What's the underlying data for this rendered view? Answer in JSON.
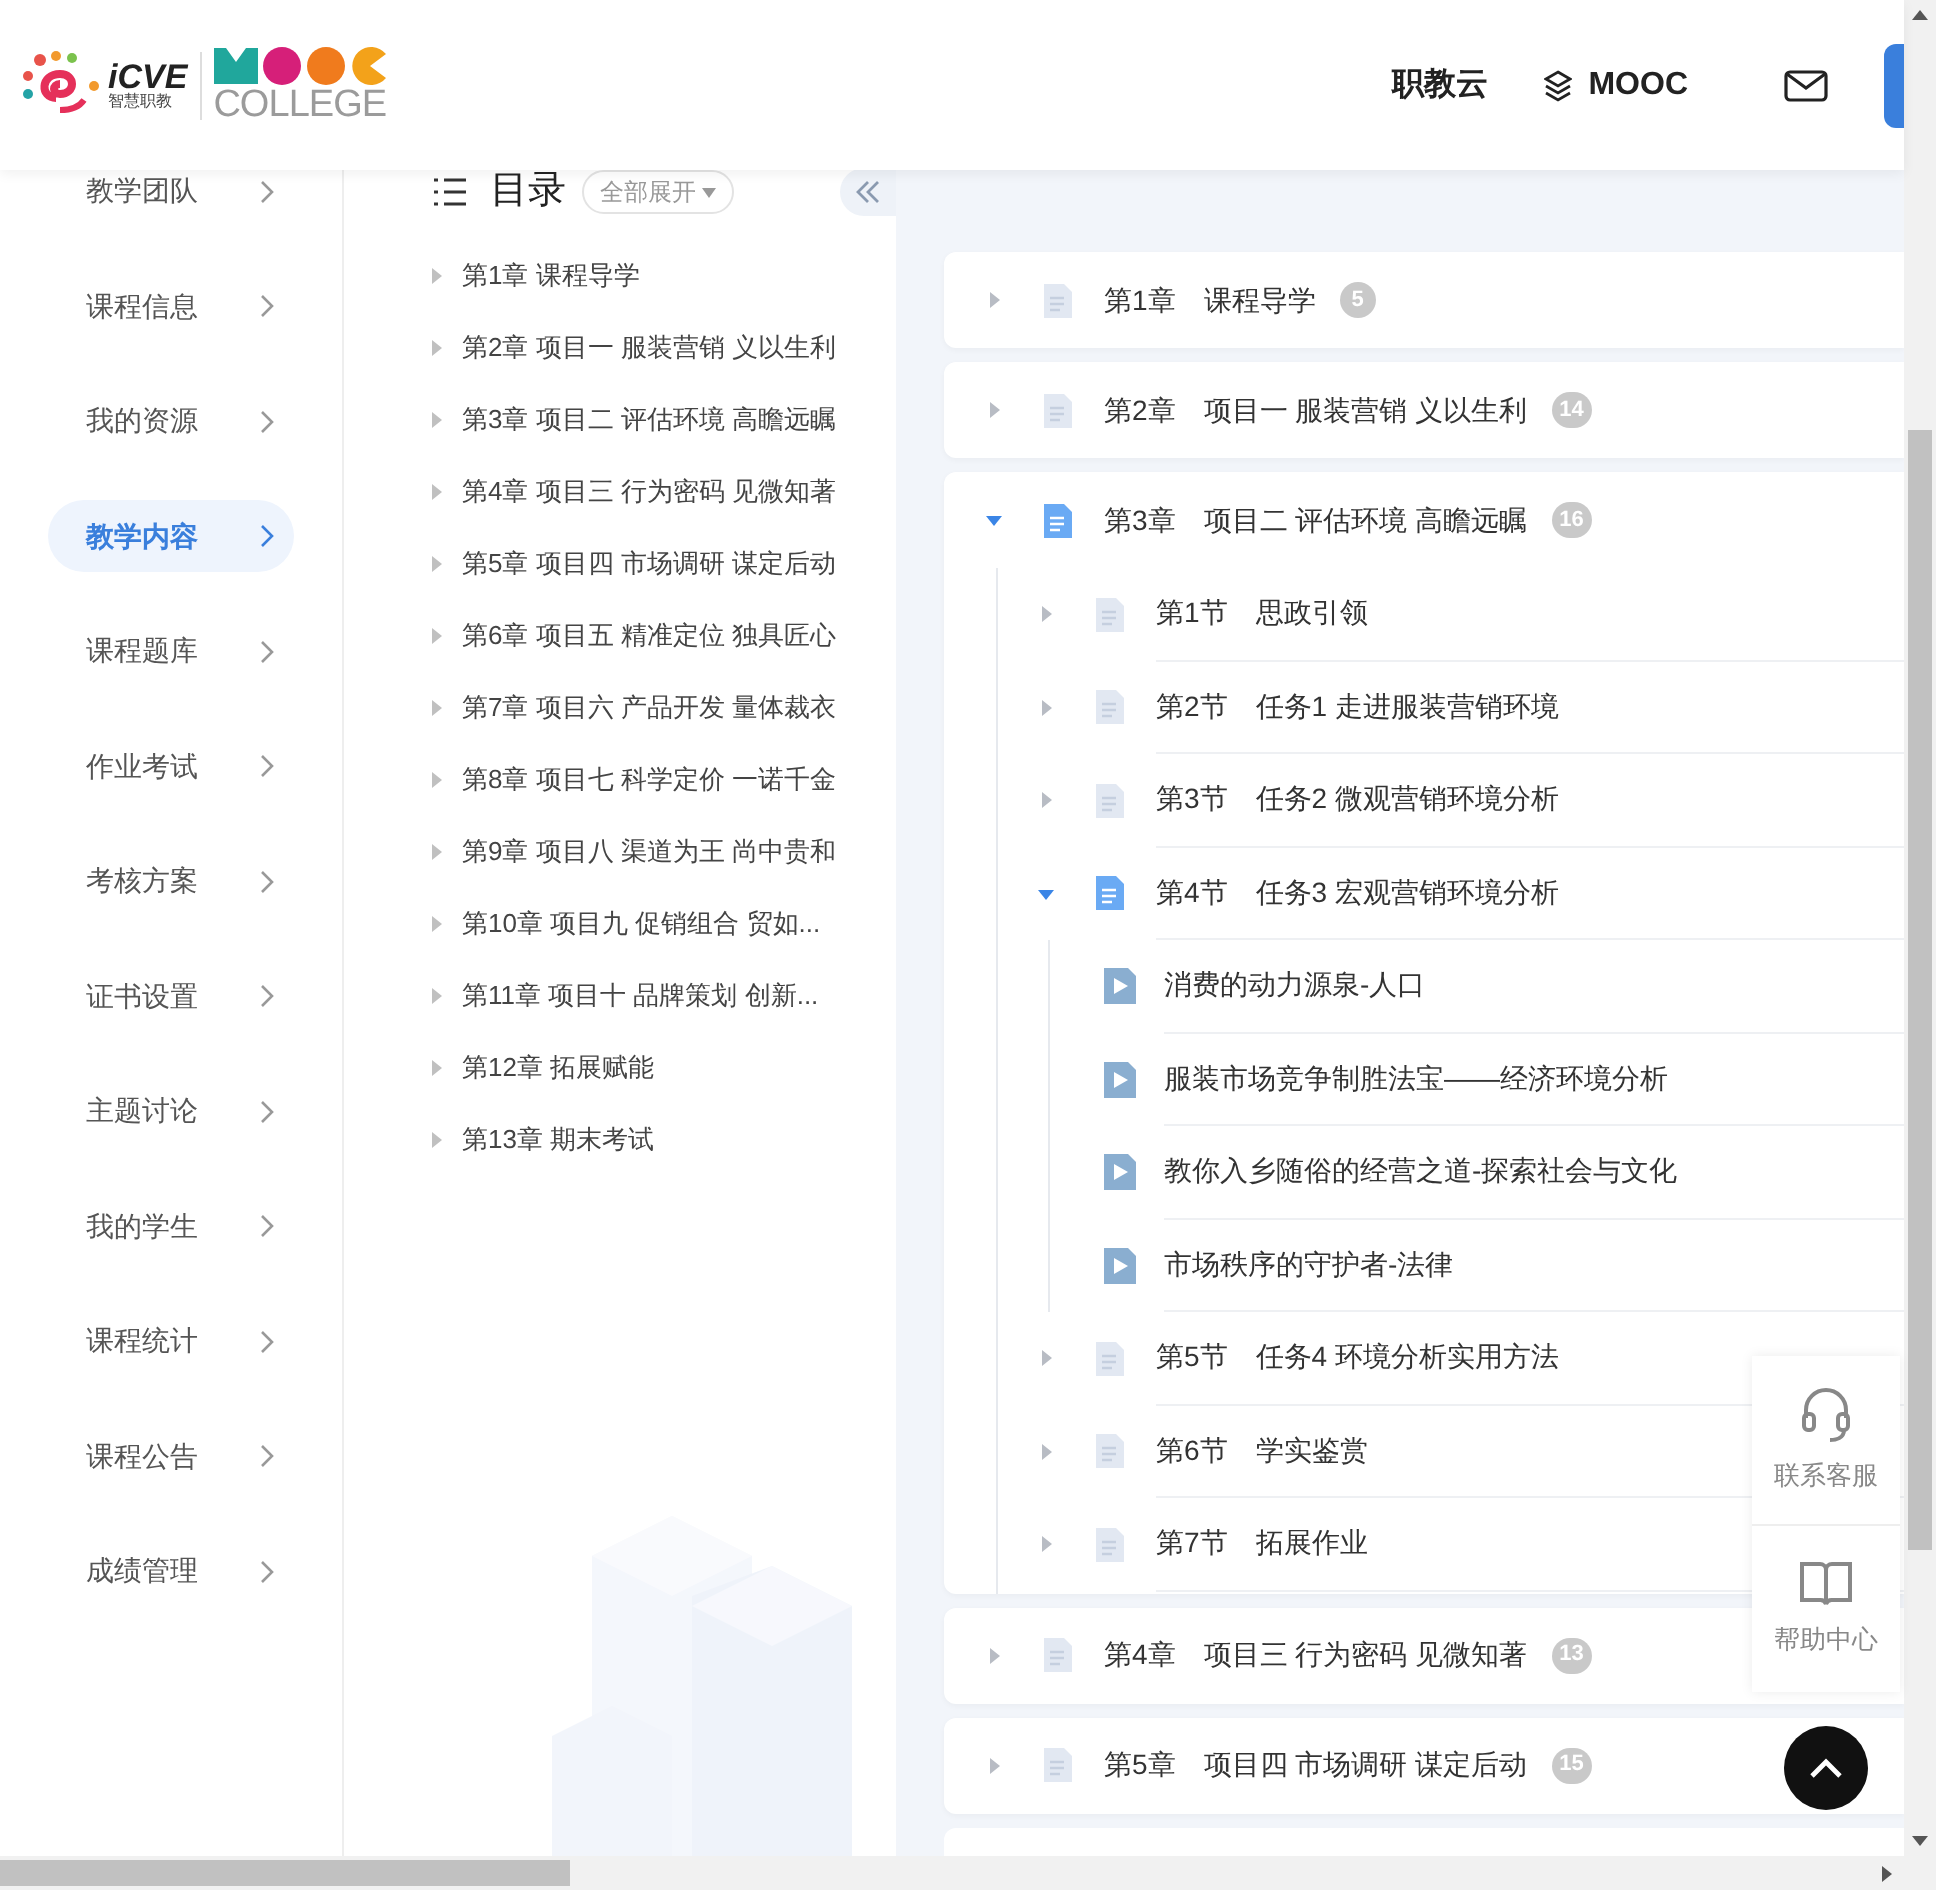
{
  "header": {
    "logo": {
      "brand": "iCVE",
      "brand_sub": "智慧职教",
      "college": "COLLEGE"
    },
    "nav": [
      {
        "label": "职教云",
        "kind": "text"
      },
      {
        "label": "MOOC",
        "kind": "layers"
      }
    ]
  },
  "sidebar": {
    "items": [
      {
        "label": "教学团队",
        "selected": false
      },
      {
        "label": "课程信息",
        "selected": false
      },
      {
        "label": "我的资源",
        "selected": false
      },
      {
        "label": "教学内容",
        "selected": true
      },
      {
        "label": "课程题库",
        "selected": false
      },
      {
        "label": "作业考试",
        "selected": false
      },
      {
        "label": "考核方案",
        "selected": false
      },
      {
        "label": "证书设置",
        "selected": false
      },
      {
        "label": "主题讨论",
        "selected": false
      },
      {
        "label": "我的学生",
        "selected": false
      },
      {
        "label": "课程统计",
        "selected": false
      },
      {
        "label": "课程公告",
        "selected": false
      },
      {
        "label": "成绩管理",
        "selected": false
      }
    ]
  },
  "catalog": {
    "title": "目录",
    "expand_all": "全部展开",
    "chapters": [
      {
        "label": "第1章 课程导学"
      },
      {
        "label": "第2章 项目一 服装营销 义以生利"
      },
      {
        "label": "第3章 项目二 评估环境 高瞻远瞩"
      },
      {
        "label": "第4章 项目三 行为密码 见微知著"
      },
      {
        "label": "第5章 项目四 市场调研 谋定后动"
      },
      {
        "label": "第6章 项目五 精准定位 独具匠心"
      },
      {
        "label": "第7章 项目六 产品开发 量体裁衣"
      },
      {
        "label": "第8章 项目七 科学定价 一诺千金"
      },
      {
        "label": "第9章 项目八 渠道为王 尚中贵和"
      },
      {
        "label": "第10章 项目九 促销组合 贸如..."
      },
      {
        "label": "第11章 项目十 品牌策划 创新..."
      },
      {
        "label": "第12章 拓展赋能"
      },
      {
        "label": "第13章 期末考试"
      }
    ]
  },
  "content": {
    "chapters": [
      {
        "number": "第1章",
        "title": "课程导学",
        "count": "5",
        "expanded": false
      },
      {
        "number": "第2章",
        "title": "项目一 服装营销 义以生利",
        "count": "14",
        "expanded": false
      },
      {
        "number": "第3章",
        "title": "项目二 评估环境 高瞻远瞩",
        "count": "16",
        "expanded": true,
        "children": [
          {
            "number": "第1节",
            "title": "思政引领",
            "expanded": false
          },
          {
            "number": "第2节",
            "title": "任务1 走进服装营销环境",
            "expanded": false
          },
          {
            "number": "第3节",
            "title": "任务2 微观营销环境分析",
            "expanded": false
          },
          {
            "number": "第4节",
            "title": "任务3 宏观营销环境分析",
            "expanded": true,
            "children": [
              {
                "title": "消费的动力源泉-人口",
                "kind": "video"
              },
              {
                "title": "服装市场竞争制胜法宝——经济环境分析",
                "kind": "video"
              },
              {
                "title": "教你入乡随俗的经营之道-探索社会与文化",
                "kind": "video"
              },
              {
                "title": "市场秩序的守护者-法律",
                "kind": "video"
              }
            ]
          },
          {
            "number": "第5节",
            "title": "任务4 环境分析实用方法",
            "expanded": false
          },
          {
            "number": "第6节",
            "title": "学实鉴赏",
            "expanded": false
          },
          {
            "number": "第7节",
            "title": "拓展作业",
            "expanded": false
          }
        ]
      },
      {
        "number": "第4章",
        "title": "项目三 行为密码 见微知著",
        "count": "13",
        "expanded": false
      },
      {
        "number": "第5章",
        "title": "项目四 市场调研 谋定后动",
        "count": "15",
        "expanded": false
      }
    ]
  },
  "float_panel": [
    {
      "label": "联系客服",
      "kind": "headset"
    },
    {
      "label": "帮助中心",
      "kind": "book"
    }
  ]
}
